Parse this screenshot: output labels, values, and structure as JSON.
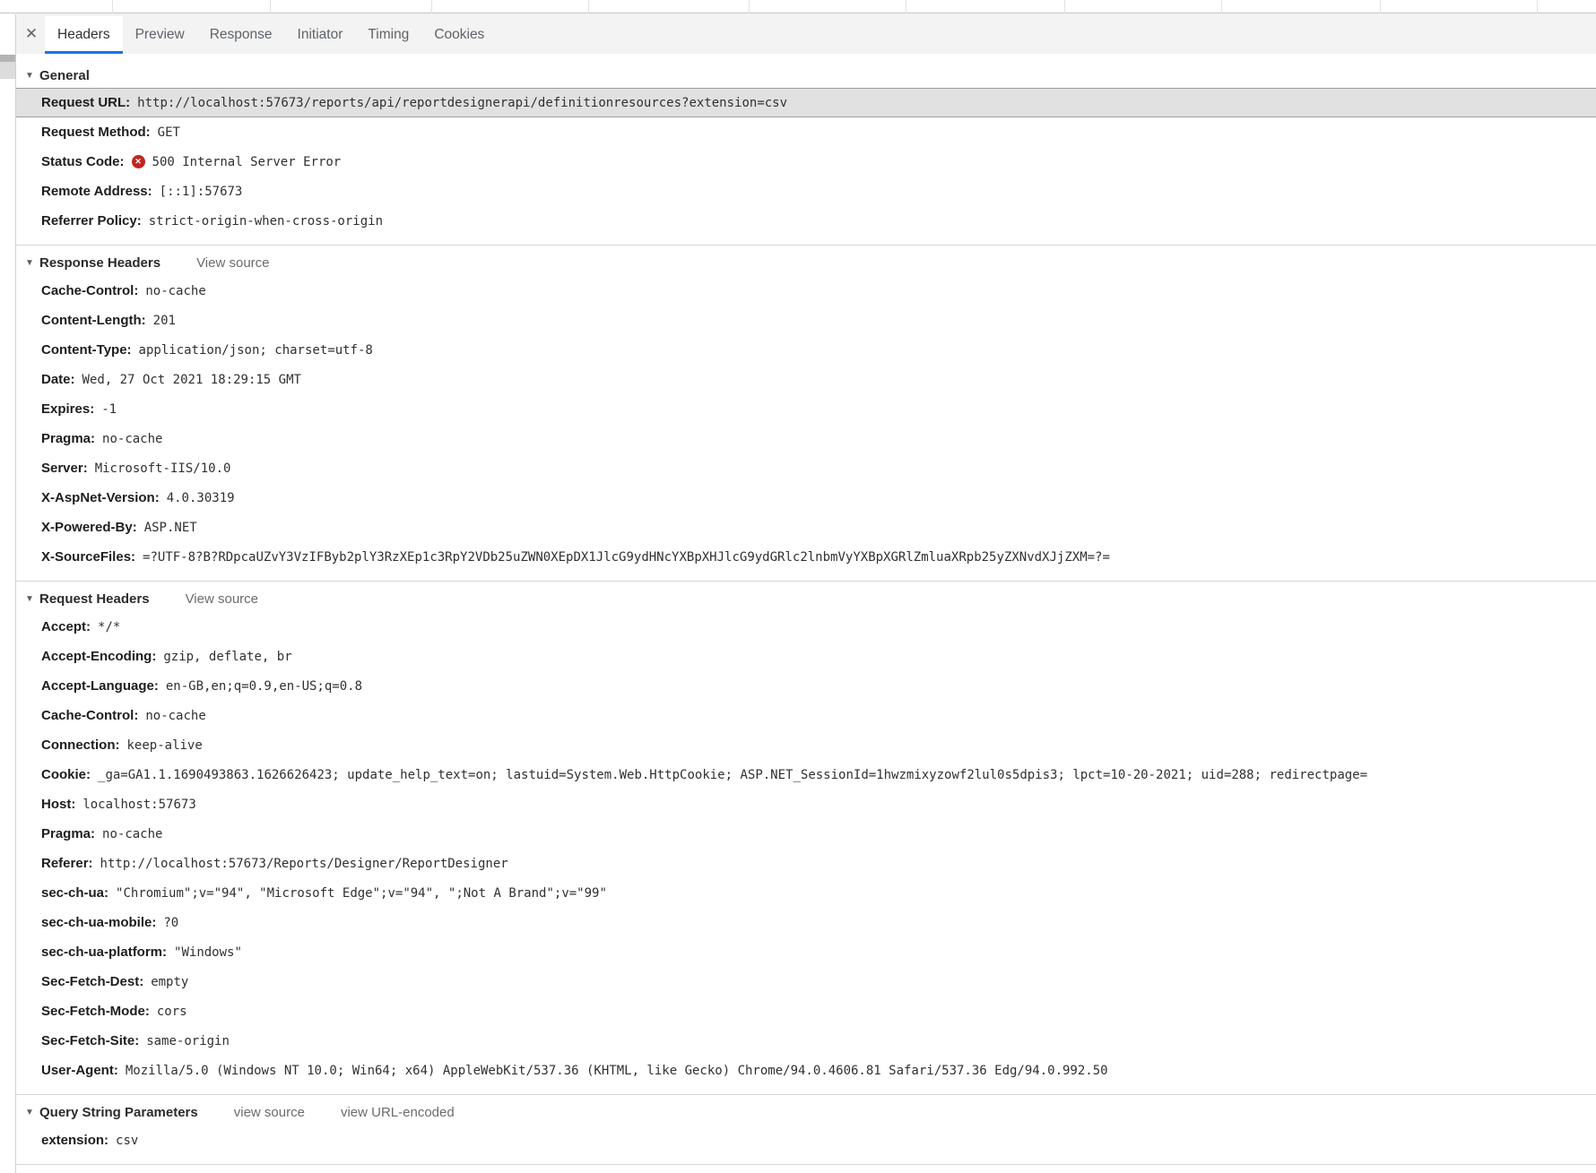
{
  "glyphs": {
    "triangle": "▼",
    "close": "✕",
    "error_x": "✕"
  },
  "colors": {
    "accent": "#1a73e8",
    "error": "#c5221f",
    "highlight_row": "#e1e1e1"
  },
  "tabbar": {
    "close_label": "✕",
    "tabs": [
      {
        "id": "headers",
        "label": "Headers",
        "active": true
      },
      {
        "id": "preview",
        "label": "Preview",
        "active": false
      },
      {
        "id": "response",
        "label": "Response",
        "active": false
      },
      {
        "id": "initiator",
        "label": "Initiator",
        "active": false
      },
      {
        "id": "timing",
        "label": "Timing",
        "active": false
      },
      {
        "id": "cookies",
        "label": "Cookies",
        "active": false
      }
    ]
  },
  "sections": [
    {
      "id": "general",
      "title": "General",
      "links": [],
      "rows": [
        {
          "name": "Request URL:",
          "value": "http://localhost:57673/reports/api/reportdesignerapi/definitionresources?extension=csv",
          "highlight": true
        },
        {
          "name": "Request Method:",
          "value": "GET"
        },
        {
          "name": "Status Code:",
          "value": "500 Internal Server Error",
          "error": true
        },
        {
          "name": "Remote Address:",
          "value": "[::1]:57673"
        },
        {
          "name": "Referrer Policy:",
          "value": "strict-origin-when-cross-origin"
        }
      ]
    },
    {
      "id": "response-headers",
      "title": "Response Headers",
      "links": [
        {
          "id": "view-source",
          "label": "View source"
        }
      ],
      "rows": [
        {
          "name": "Cache-Control:",
          "value": "no-cache"
        },
        {
          "name": "Content-Length:",
          "value": "201"
        },
        {
          "name": "Content-Type:",
          "value": "application/json; charset=utf-8"
        },
        {
          "name": "Date:",
          "value": "Wed, 27 Oct 2021 18:29:15 GMT"
        },
        {
          "name": "Expires:",
          "value": "-1"
        },
        {
          "name": "Pragma:",
          "value": "no-cache"
        },
        {
          "name": "Server:",
          "value": "Microsoft-IIS/10.0"
        },
        {
          "name": "X-AspNet-Version:",
          "value": "4.0.30319"
        },
        {
          "name": "X-Powered-By:",
          "value": "ASP.NET"
        },
        {
          "name": "X-SourceFiles:",
          "value": "=?UTF-8?B?RDpcaUZvY3VzIFByb2plY3RzXEp1c3RpY2VDb25uZWN0XEpDX1JlcG9ydHNcYXBpXHJlcG9ydGRlc2lnbmVyYXBpXGRlZmluaXRpb25yZXNvdXJjZXM=?="
        }
      ]
    },
    {
      "id": "request-headers",
      "title": "Request Headers",
      "links": [
        {
          "id": "view-source",
          "label": "View source"
        }
      ],
      "rows": [
        {
          "name": "Accept:",
          "value": "*/*"
        },
        {
          "name": "Accept-Encoding:",
          "value": "gzip, deflate, br"
        },
        {
          "name": "Accept-Language:",
          "value": "en-GB,en;q=0.9,en-US;q=0.8"
        },
        {
          "name": "Cache-Control:",
          "value": "no-cache"
        },
        {
          "name": "Connection:",
          "value": "keep-alive"
        },
        {
          "name": "Cookie:",
          "value": "_ga=GA1.1.1690493863.1626626423; update_help_text=on; lastuid=System.Web.HttpCookie; ASP.NET_SessionId=1hwzmixyzowf2lul0s5dpis3; lpct=10-20-2021; uid=288; redirectpage="
        },
        {
          "name": "Host:",
          "value": "localhost:57673"
        },
        {
          "name": "Pragma:",
          "value": "no-cache"
        },
        {
          "name": "Referer:",
          "value": "http://localhost:57673/Reports/Designer/ReportDesigner"
        },
        {
          "name": "sec-ch-ua:",
          "value": "\"Chromium\";v=\"94\", \"Microsoft Edge\";v=\"94\", \";Not A Brand\";v=\"99\""
        },
        {
          "name": "sec-ch-ua-mobile:",
          "value": "?0"
        },
        {
          "name": "sec-ch-ua-platform:",
          "value": "\"Windows\""
        },
        {
          "name": "Sec-Fetch-Dest:",
          "value": "empty"
        },
        {
          "name": "Sec-Fetch-Mode:",
          "value": "cors"
        },
        {
          "name": "Sec-Fetch-Site:",
          "value": "same-origin"
        },
        {
          "name": "User-Agent:",
          "value": "Mozilla/5.0 (Windows NT 10.0; Win64; x64) AppleWebKit/537.36 (KHTML, like Gecko) Chrome/94.0.4606.81 Safari/537.36 Edg/94.0.992.50"
        }
      ]
    },
    {
      "id": "query-string-parameters",
      "title": "Query String Parameters",
      "links": [
        {
          "id": "view-source",
          "label": "view source"
        },
        {
          "id": "view-url-encoded",
          "label": "view URL-encoded"
        }
      ],
      "rows": [
        {
          "name": "extension:",
          "value": "csv"
        }
      ]
    }
  ]
}
